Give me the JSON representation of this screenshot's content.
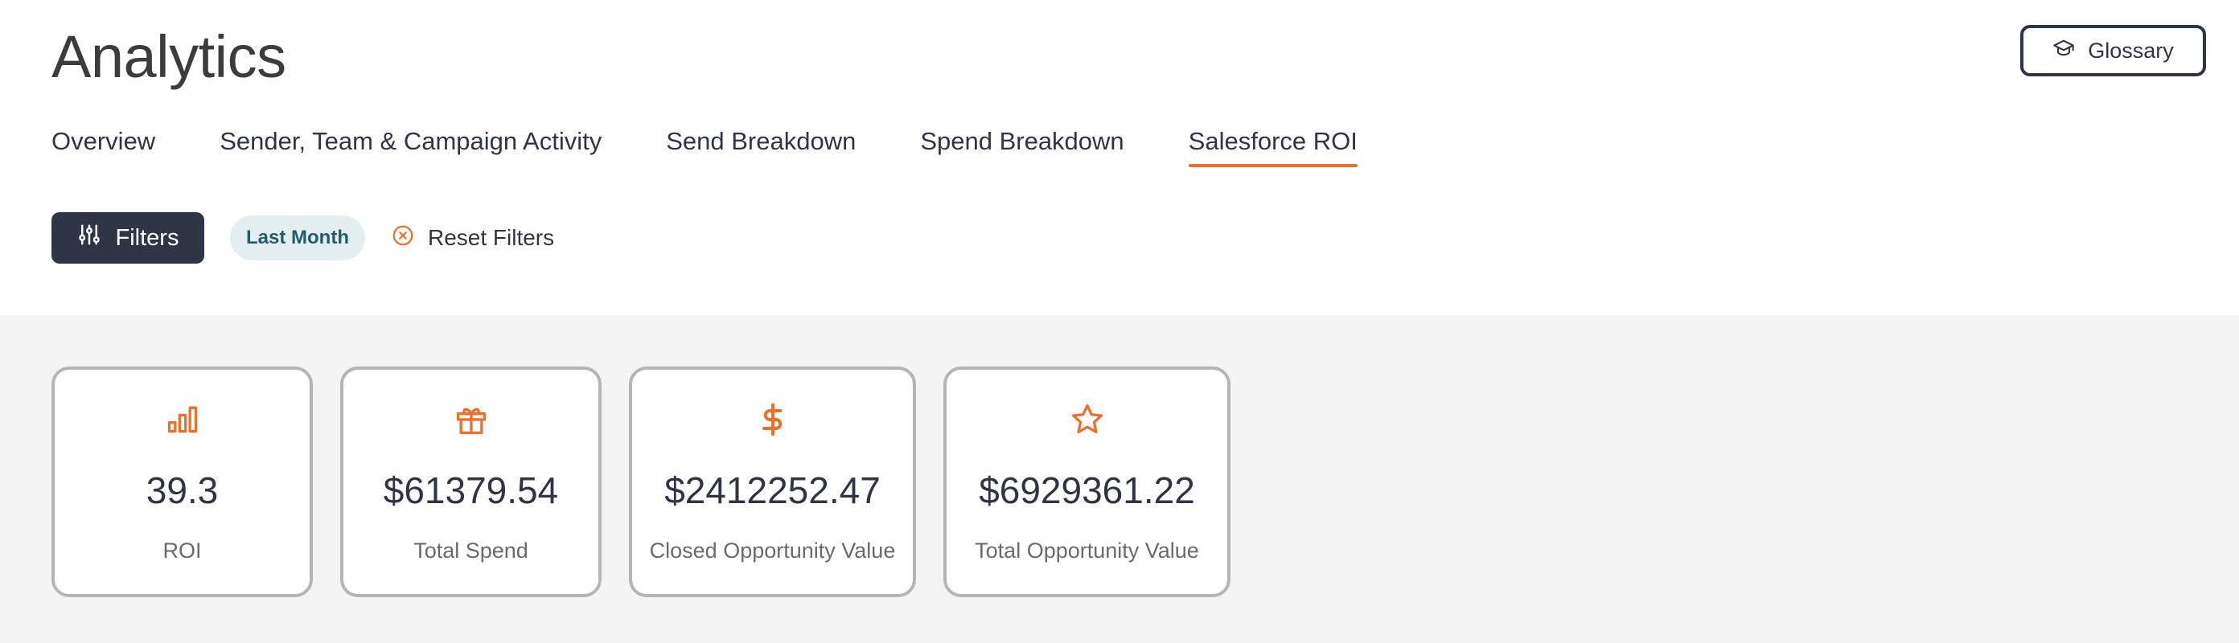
{
  "header": {
    "title": "Analytics",
    "glossary_label": "Glossary",
    "glossary_icon": "graduation-cap-icon"
  },
  "tabs": [
    {
      "label": "Overview",
      "active": false
    },
    {
      "label": "Sender, Team & Campaign Activity",
      "active": false
    },
    {
      "label": "Send Breakdown",
      "active": false
    },
    {
      "label": "Spend Breakdown",
      "active": false
    },
    {
      "label": "Salesforce ROI",
      "active": true
    }
  ],
  "filters": {
    "button_label": "Filters",
    "button_icon": "sliders-icon",
    "active_chip": "Last Month",
    "reset_label": "Reset Filters",
    "reset_icon": "circle-x-icon"
  },
  "cards": [
    {
      "icon": "bar-chart-icon",
      "value": "39.3",
      "label": "ROI"
    },
    {
      "icon": "gift-icon",
      "value": "$61379.54",
      "label": "Total Spend"
    },
    {
      "icon": "dollar-icon",
      "value": "$2412252.47",
      "label": "Closed Opportunity Value"
    },
    {
      "icon": "star-icon",
      "value": "$6929361.22",
      "label": "Total Opportunity Value"
    }
  ],
  "colors": {
    "accent": "#e9702d",
    "primary": "#2f3545",
    "chip_bg": "#e4eff2",
    "chip_text": "#1f5d6b",
    "panel_bg": "#f4f4f4"
  }
}
